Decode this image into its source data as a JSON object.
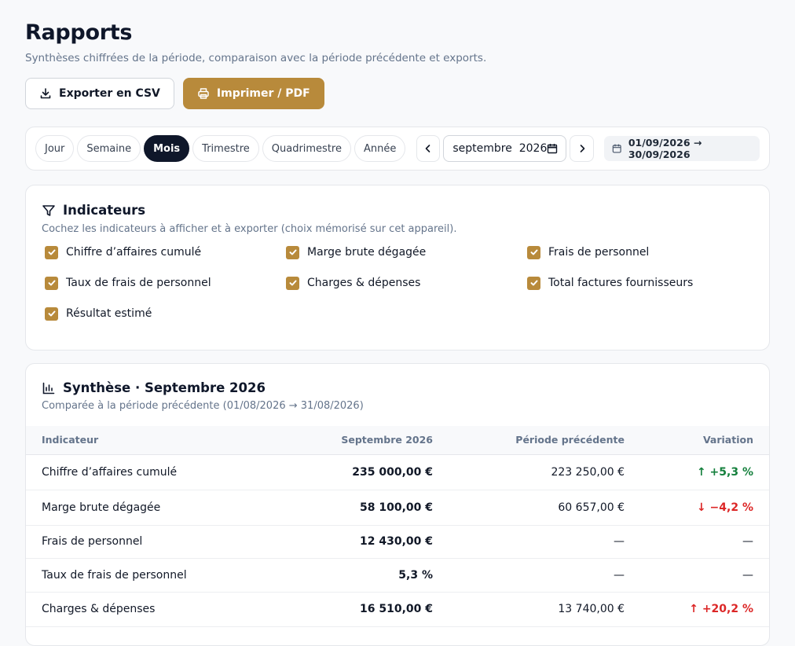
{
  "header": {
    "title": "Rapports",
    "subtitle": "Synthèses chiffrées de la période, comparaison avec la période précédente et exports."
  },
  "actions": {
    "export_label": "Exporter en CSV",
    "print_label": "Imprimer / PDF"
  },
  "period": {
    "options": [
      "Jour",
      "Semaine",
      "Mois",
      "Trimestre",
      "Quadrimestre",
      "Année"
    ],
    "selected": "Mois",
    "month_value": "septembre  2026",
    "range": "01/09/2026 → 30/09/2026"
  },
  "indicators": {
    "title": "Indicateurs",
    "subtitle": "Cochez les indicateurs à afficher et à exporter (choix mémorisé sur cet appareil).",
    "items": [
      {
        "label": "Chiffre d’affaires cumulé",
        "checked": true
      },
      {
        "label": "Marge brute dégagée",
        "checked": true
      },
      {
        "label": "Frais de personnel",
        "checked": true
      },
      {
        "label": "Taux de frais de personnel",
        "checked": true
      },
      {
        "label": "Charges & dépenses",
        "checked": true
      },
      {
        "label": "Total factures fournisseurs",
        "checked": true
      },
      {
        "label": "Résultat estimé",
        "checked": true
      }
    ]
  },
  "summary": {
    "title": "Synthèse · Septembre 2026",
    "subtitle": "Comparée à la période précédente (01/08/2026 → 31/08/2026)",
    "columns": [
      "Indicateur",
      "Septembre 2026",
      "Période précédente",
      "Variation"
    ],
    "rows": [
      {
        "label": "Chiffre d’affaires cumulé",
        "current": "235 000,00 €",
        "previous": "223 250,00 €",
        "variation": "↑ +5,3 %",
        "trend": "up"
      },
      {
        "label": "Marge brute dégagée",
        "current": "58 100,00 €",
        "previous": "60 657,00 €",
        "variation": "↓ −4,2 %",
        "trend": "down"
      },
      {
        "label": "Frais de personnel",
        "current": "12 430,00 €",
        "previous": "—",
        "variation": "—",
        "trend": "none"
      },
      {
        "label": "Taux de frais de personnel",
        "current": "5,3 %",
        "previous": "—",
        "variation": "—",
        "trend": "none"
      },
      {
        "label": "Charges & dépenses",
        "current": "16 510,00 €",
        "previous": "13 740,00 €",
        "variation": "↑ +20,2 %",
        "trend": "up-bad"
      }
    ]
  },
  "colors": {
    "accent": "#b88a3b",
    "dark": "#0f172a",
    "positive": "#15803d",
    "negative": "#dc2626"
  }
}
